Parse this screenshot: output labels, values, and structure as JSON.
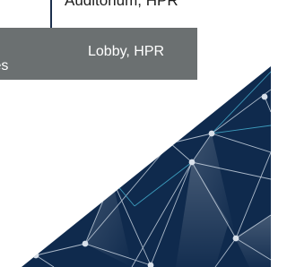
{
  "top_label": "Auditorium, HPR",
  "bar": {
    "left_partial_text": "tes",
    "right_text": "Lobby, HPR"
  },
  "colors": {
    "navy": "#0f2a4d",
    "bar_gray": "#6b7071",
    "node": "#d8e0ea",
    "line_light": "#c7d3e0",
    "line_cyan": "#48b8d8",
    "accent_line": "#1c2f4d"
  }
}
